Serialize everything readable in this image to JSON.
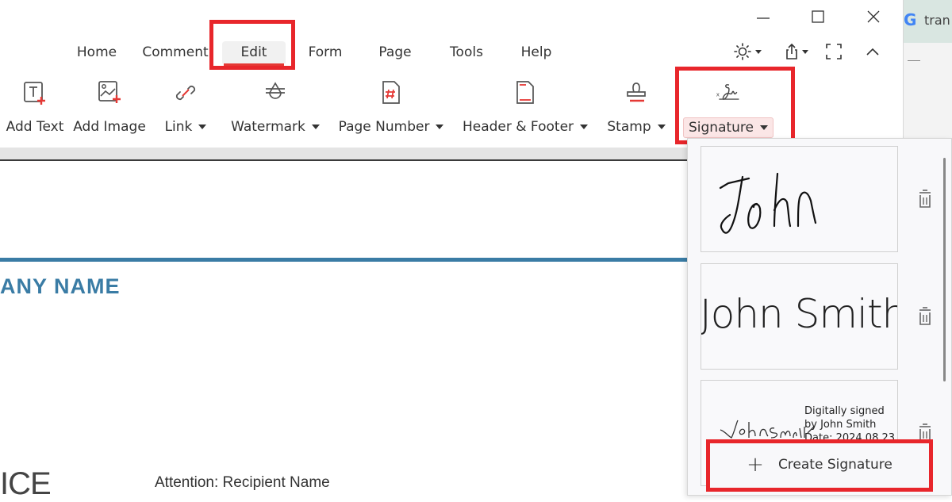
{
  "window": {
    "controls": [
      "minimize",
      "maximize",
      "close"
    ]
  },
  "browser_strip": {
    "tab_text": "tran",
    "tab_icon": "google-icon"
  },
  "menu": {
    "tabs": [
      {
        "label": "Home",
        "active": false
      },
      {
        "label": "Comment",
        "active": false
      },
      {
        "label": "Edit",
        "active": true
      },
      {
        "label": "Form",
        "active": false
      },
      {
        "label": "Page",
        "active": false
      },
      {
        "label": "Tools",
        "active": false
      },
      {
        "label": "Help",
        "active": false
      }
    ],
    "right_tools": [
      "theme-icon",
      "share-icon",
      "fullscreen-icon",
      "collapse-ribbon-icon"
    ]
  },
  "ribbon": {
    "buttons": [
      {
        "label": "Add Text",
        "icon": "add-text-icon",
        "dropdown": false
      },
      {
        "label": "Add Image",
        "icon": "add-image-icon",
        "dropdown": false
      },
      {
        "label": "Link",
        "icon": "link-icon",
        "dropdown": true
      },
      {
        "label": "Watermark",
        "icon": "watermark-icon",
        "dropdown": true
      },
      {
        "label": "Page Number",
        "icon": "page-number-icon",
        "dropdown": true
      },
      {
        "label": "Header & Footer",
        "icon": "header-footer-icon",
        "dropdown": true
      },
      {
        "label": "Stamp",
        "icon": "stamp-icon",
        "dropdown": true
      },
      {
        "label": "Signature",
        "icon": "signature-icon",
        "dropdown": true,
        "pressed": true
      }
    ]
  },
  "document": {
    "company": "ANY NAME",
    "title_fragment": "ICE",
    "attention": "Attention: Recipient Name",
    "accent_color": "#3a7ca5"
  },
  "signature_panel": {
    "signatures": [
      {
        "type": "handwritten",
        "text": "John"
      },
      {
        "type": "typed",
        "text": "John Smith"
      },
      {
        "type": "digital",
        "text": "John Smith",
        "caption_lines": [
          "Digitally signed",
          "by John Smith",
          "Date: 2024.08.23"
        ]
      }
    ],
    "create_label": "Create Signature"
  },
  "highlight_color": "#e8262b"
}
